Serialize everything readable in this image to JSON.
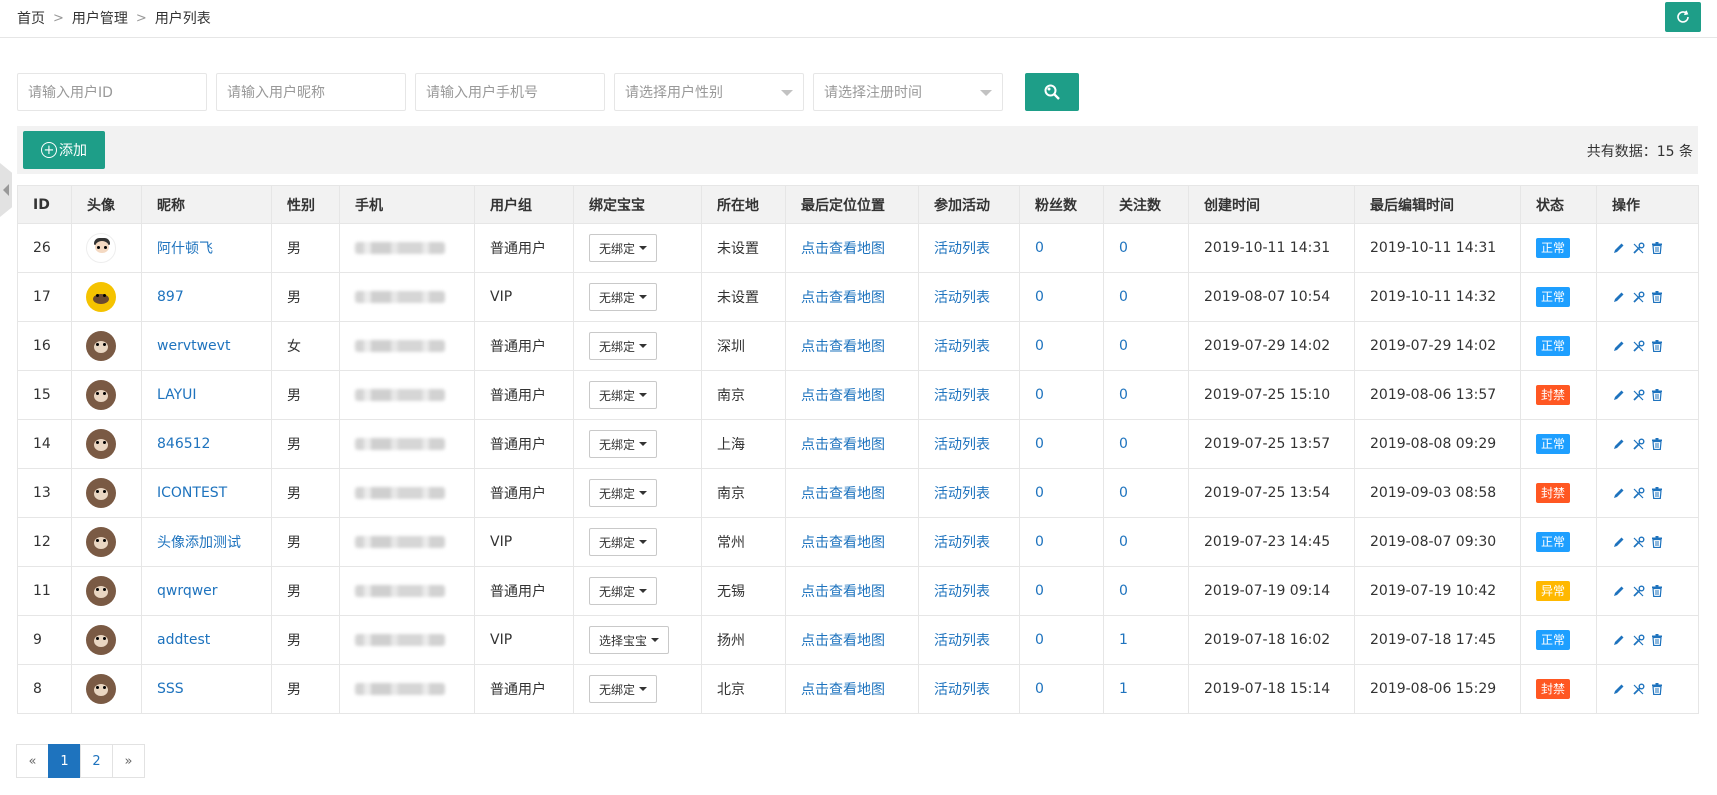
{
  "breadcrumb": {
    "items": [
      "首页",
      "用户管理",
      "用户列表"
    ],
    "separator": ">"
  },
  "icons": {
    "refresh": "refresh-icon",
    "search": "search-icon",
    "add": "plus-circle-icon",
    "edit": "pencil-icon",
    "tools": "tools-icon",
    "delete": "trash-icon"
  },
  "colors": {
    "brand": "#1e9e88",
    "link": "#1e73be",
    "status_normal": "#1e9fff",
    "status_banned": "#ff5722",
    "status_abnormal": "#ffb800"
  },
  "filters": {
    "user_id_placeholder": "请输入用户ID",
    "nickname_placeholder": "请输入用户昵称",
    "phone_placeholder": "请输入用户手机号",
    "gender_placeholder": "请选择用户性别",
    "regtime_placeholder": "请选择注册时间"
  },
  "toolbar": {
    "add_label": "添加",
    "add_plus": "+",
    "total_label": "共有数据：15 条"
  },
  "table": {
    "headers": [
      "ID",
      "头像",
      "昵称",
      "性别",
      "手机",
      "用户组",
      "绑定宝宝",
      "所在地",
      "最后定位位置",
      "参加活动",
      "粉丝数",
      "关注数",
      "创建时间",
      "最后编辑时间",
      "状态",
      "操作"
    ],
    "rows": [
      {
        "id": "26",
        "avatar": "man",
        "nickname": "阿什顿飞",
        "gender": "男",
        "group": "普通用户",
        "bind": "无绑定",
        "location": "未设置",
        "map": "点击查看地图",
        "activity": "活动列表",
        "fans": "0",
        "follow": "0",
        "created": "2019-10-11 14:31",
        "edited": "2019-10-11 14:31",
        "status": "正常",
        "status_type": "normal"
      },
      {
        "id": "17",
        "avatar": "yellow",
        "nickname": "897",
        "gender": "男",
        "group": "VIP",
        "bind": "无绑定",
        "location": "未设置",
        "map": "点击查看地图",
        "activity": "活动列表",
        "fans": "0",
        "follow": "0",
        "created": "2019-08-07 10:54",
        "edited": "2019-10-11 14:32",
        "status": "正常",
        "status_type": "normal"
      },
      {
        "id": "16",
        "avatar": "bear",
        "nickname": "wervtwevt",
        "gender": "女",
        "group": "普通用户",
        "bind": "无绑定",
        "location": "深圳",
        "map": "点击查看地图",
        "activity": "活动列表",
        "fans": "0",
        "follow": "0",
        "created": "2019-07-29 14:02",
        "edited": "2019-07-29 14:02",
        "status": "正常",
        "status_type": "normal"
      },
      {
        "id": "15",
        "avatar": "bear",
        "nickname": "LAYUI",
        "gender": "男",
        "group": "普通用户",
        "bind": "无绑定",
        "location": "南京",
        "map": "点击查看地图",
        "activity": "活动列表",
        "fans": "0",
        "follow": "0",
        "created": "2019-07-25 15:10",
        "edited": "2019-08-06 13:57",
        "status": "封禁",
        "status_type": "banned"
      },
      {
        "id": "14",
        "avatar": "bear",
        "nickname": "846512",
        "gender": "男",
        "group": "普通用户",
        "bind": "无绑定",
        "location": "上海",
        "map": "点击查看地图",
        "activity": "活动列表",
        "fans": "0",
        "follow": "0",
        "created": "2019-07-25 13:57",
        "edited": "2019-08-08 09:29",
        "status": "正常",
        "status_type": "normal"
      },
      {
        "id": "13",
        "avatar": "bear",
        "nickname": "ICONTEST",
        "gender": "男",
        "group": "普通用户",
        "bind": "无绑定",
        "location": "南京",
        "map": "点击查看地图",
        "activity": "活动列表",
        "fans": "0",
        "follow": "0",
        "created": "2019-07-25 13:54",
        "edited": "2019-09-03 08:58",
        "status": "封禁",
        "status_type": "banned"
      },
      {
        "id": "12",
        "avatar": "bear",
        "nickname": "头像添加测试",
        "gender": "男",
        "group": "VIP",
        "bind": "无绑定",
        "location": "常州",
        "map": "点击查看地图",
        "activity": "活动列表",
        "fans": "0",
        "follow": "0",
        "created": "2019-07-23 14:45",
        "edited": "2019-08-07 09:30",
        "status": "正常",
        "status_type": "normal"
      },
      {
        "id": "11",
        "avatar": "bear",
        "nickname": "qwrqwer",
        "gender": "男",
        "group": "普通用户",
        "bind": "无绑定",
        "location": "无锡",
        "map": "点击查看地图",
        "activity": "活动列表",
        "fans": "0",
        "follow": "0",
        "created": "2019-07-19 09:14",
        "edited": "2019-07-19 10:42",
        "status": "异常",
        "status_type": "abnormal"
      },
      {
        "id": "9",
        "avatar": "bear",
        "nickname": "addtest",
        "gender": "男",
        "group": "VIP",
        "bind": "选择宝宝",
        "location": "扬州",
        "map": "点击查看地图",
        "activity": "活动列表",
        "fans": "0",
        "follow": "1",
        "created": "2019-07-18 16:02",
        "edited": "2019-07-18 17:45",
        "status": "正常",
        "status_type": "normal"
      },
      {
        "id": "8",
        "avatar": "bear",
        "nickname": "SSS",
        "gender": "男",
        "group": "普通用户",
        "bind": "无绑定",
        "location": "北京",
        "map": "点击查看地图",
        "activity": "活动列表",
        "fans": "0",
        "follow": "1",
        "created": "2019-07-18 15:14",
        "edited": "2019-08-06 15:29",
        "status": "封禁",
        "status_type": "banned"
      }
    ]
  },
  "pagination": {
    "prev": "«",
    "pages": [
      "1",
      "2"
    ],
    "current": "1",
    "next": "»"
  }
}
